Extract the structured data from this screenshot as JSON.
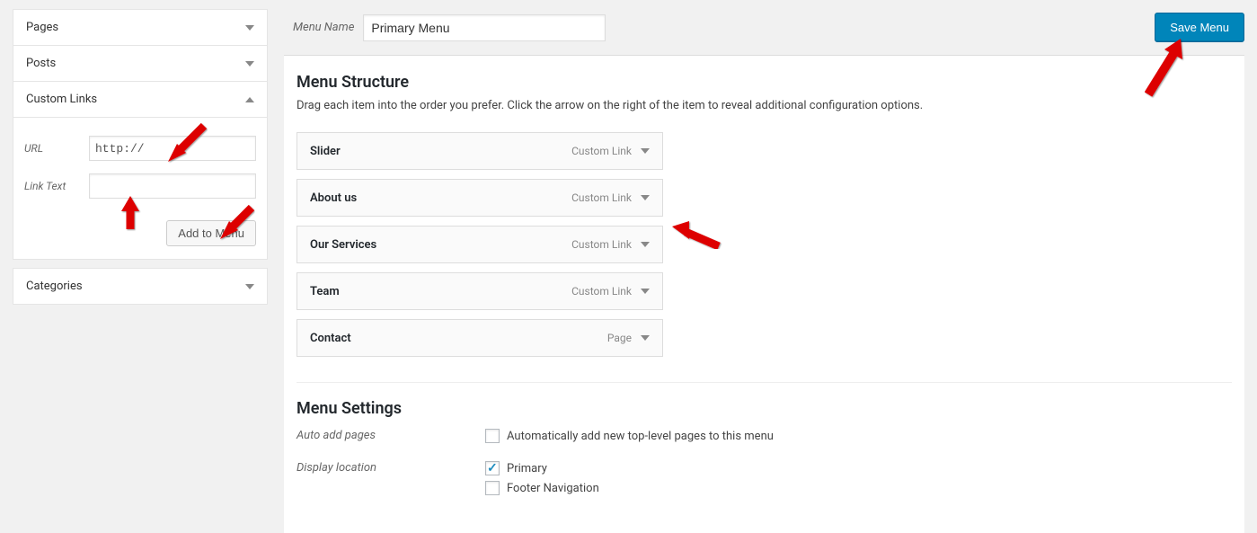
{
  "sidebar": {
    "panels": {
      "pages": "Pages",
      "posts": "Posts",
      "custom": "Custom Links",
      "categories": "Categories"
    },
    "custom": {
      "url_label": "URL",
      "url_value": "http://",
      "link_text_label": "Link Text",
      "link_text_value": "",
      "add_button": "Add to Menu"
    }
  },
  "header": {
    "menu_name_label": "Menu Name",
    "menu_name_value": "Primary Menu",
    "save_button": "Save Menu"
  },
  "structure": {
    "heading": "Menu Structure",
    "description": "Drag each item into the order you prefer. Click the arrow on the right of the item to reveal additional configuration options.",
    "items": [
      {
        "title": "Slider",
        "type": "Custom Link"
      },
      {
        "title": "About us",
        "type": "Custom Link"
      },
      {
        "title": "Our Services",
        "type": "Custom Link"
      },
      {
        "title": "Team",
        "type": "Custom Link"
      },
      {
        "title": "Contact",
        "type": "Page"
      }
    ]
  },
  "settings": {
    "heading": "Menu Settings",
    "auto_add_label": "Auto add pages",
    "auto_add_checkbox": "Automatically add new top-level pages to this menu",
    "auto_add_checked": false,
    "display_label": "Display location",
    "locations": [
      {
        "label": "Primary",
        "checked": true
      },
      {
        "label": "Footer Navigation",
        "checked": false
      }
    ]
  }
}
